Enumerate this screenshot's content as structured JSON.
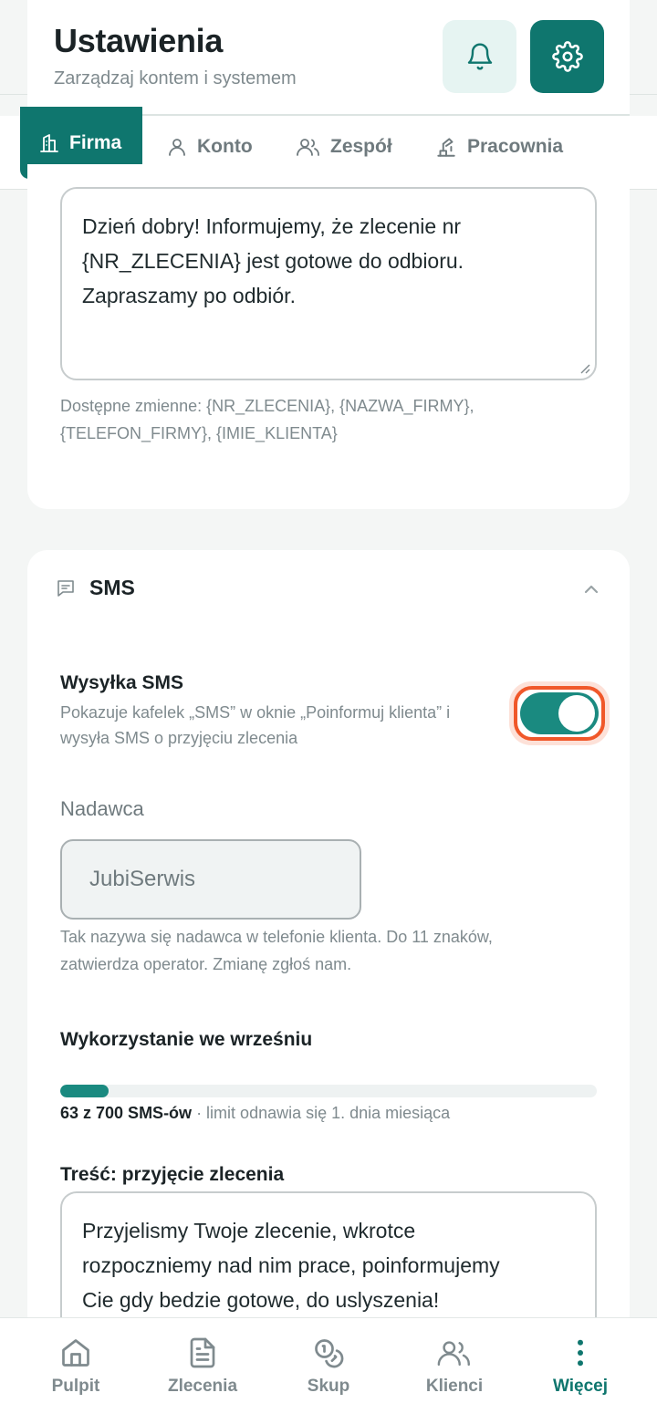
{
  "header": {
    "title": "Ustawienia",
    "subtitle": "Zarządzaj kontem i systemem",
    "bell_icon": "bell-icon",
    "gear_icon": "gear-icon"
  },
  "tabs": [
    {
      "label": "Firma",
      "icon": "building-icon",
      "active": true
    },
    {
      "label": "Konto",
      "icon": "user-icon",
      "active": false
    },
    {
      "label": "Zespół",
      "icon": "users-icon",
      "active": false
    },
    {
      "label": "Pracownia",
      "icon": "workshop-icon",
      "active": false
    }
  ],
  "ready_message": {
    "text_line1": "Dzień dobry! Informujemy, że zlecenie nr",
    "text_line2": "{NR_ZLECENIA} jest gotowe do odbioru.",
    "text_line3": "Zapraszamy po odbiór.",
    "vars_line1": "Dostępne zmienne: {NR_ZLECENIA}, {NAZWA_FIRMY},",
    "vars_line2": "{TELEFON_FIRMY}, {IMIE_KLIENTA}"
  },
  "sms": {
    "section_title": "SMS",
    "sending_label": "Wysyłka SMS",
    "sending_desc_line1": "Pokazuje kafelek „SMS” w oknie „Poinformuj klienta” i",
    "sending_desc_line2": "wysyła SMS o przyjęciu zlecenia",
    "sending_enabled": true,
    "sender_label": "Nadawca",
    "sender_value": "JubiSerwis",
    "sender_help_line1": "Tak nazywa się nadawca w telefonie klienta. Do 11 znaków,",
    "sender_help_line2": "zatwierdza operator. Zmianę zgłoś nam.",
    "usage_title": "Wykorzystanie we wrześniu",
    "usage_count": "63 z 700 SMS-ów",
    "usage_note": " · limit odnawia się 1. dnia miesiąca",
    "usage_used": 63,
    "usage_limit": 700,
    "content_label": "Treść: przyjęcie zlecenia",
    "content_line1": "Przyjelismy Twoje zlecenie, wkrotce",
    "content_line2": "rozpoczniemy nad nim prace, poinformujemy",
    "content_line3": "Cie gdy bedzie gotowe, do uslyszenia!"
  },
  "bottom_nav": [
    {
      "label": "Pulpit",
      "icon": "home-icon",
      "active": false
    },
    {
      "label": "Zlecenia",
      "icon": "document-icon",
      "active": false
    },
    {
      "label": "Skup",
      "icon": "coins-icon",
      "active": false
    },
    {
      "label": "Klienci",
      "icon": "users-icon",
      "active": false
    },
    {
      "label": "Więcej",
      "icon": "more-vertical-icon",
      "active": true
    }
  ],
  "colors": {
    "primary": "#0f766e",
    "toggle_on": "#1a8a80",
    "focus_ring": "#f0582a",
    "muted_text": "#7f8a8e"
  }
}
